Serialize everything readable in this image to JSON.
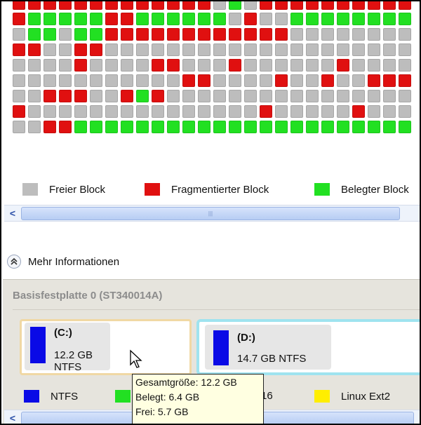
{
  "block_map": {
    "rows": [
      "xxxxxxxxxxxxxfufxxxxxxxxxx",
      "xuuuuuxxuuuuuufxffuuuuuuuu",
      "fuufuuxxxxxxxxxxxxffffffff",
      "xxffxxffffffffffffffffffff",
      "ffffxffffxxfffxffffffxffff",
      "fffffffffffxxffffxffxffxxx",
      "ffxxxffxuxffffffffffffffff",
      "xfffffffffffffffxfffffxfff",
      "ffxxuuuuuuuuuuuuuuuuuuuuuu"
    ],
    "colors": {
      "free": "#bdbdbd",
      "fragmented": "#e01010",
      "used": "#22e022"
    }
  },
  "legend_top": [
    {
      "label": "Freier Block",
      "color": "#bdbdbd"
    },
    {
      "label": "Fragmentierter Block",
      "color": "#e01010"
    },
    {
      "label": "Belegter Block",
      "color": "#22e022"
    }
  ],
  "more_info": {
    "label": "Mehr Informationen",
    "icon": "double-chevron-up-icon"
  },
  "disk": {
    "title": "Basisfestplatte 0 (ST340014A)",
    "partitions": [
      {
        "name": "(C:)",
        "info": "12.2 GB NTFS",
        "color": "#0a0ae6"
      },
      {
        "name": "(D:)",
        "info": "14.7 GB NTFS",
        "color": "#0a0ae6"
      }
    ]
  },
  "tooltip": {
    "lines": [
      "Gesamtgröße: 12.2 GB",
      "Belegt: 6.4 GB",
      "Frei: 5.7 GB"
    ]
  },
  "legend_bottom": [
    {
      "label": "NTFS",
      "color": "#0a0ae6"
    },
    {
      "label": "",
      "color": "#22e022"
    },
    {
      "label": "16",
      "color": ""
    },
    {
      "label": "Linux Ext2",
      "color": "#ffee00"
    }
  ],
  "scroll_arrow": "<"
}
